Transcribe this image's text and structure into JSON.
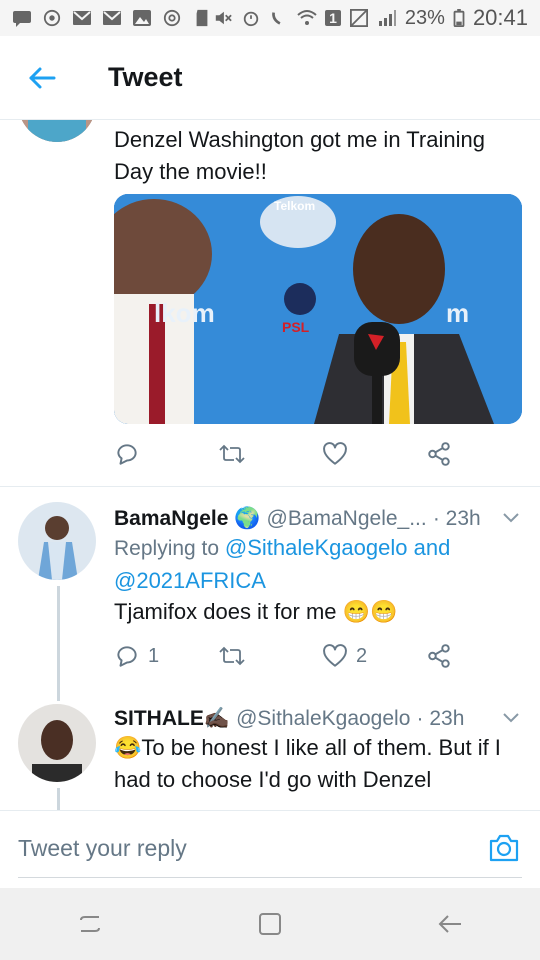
{
  "status_bar": {
    "battery_percent": "23%",
    "time": "20:41",
    "sim_badge": "1"
  },
  "header": {
    "title": "Tweet"
  },
  "tweet_main": {
    "text": "Denzel Washington got me in Training Day the movie!!",
    "media_banner_left": "lkom",
    "media_banner_right": "m",
    "media_logo_top": "Telkom",
    "media_psl": "PSL"
  },
  "replies": [
    {
      "name": "BamaNgele 🌍",
      "handle": "@BamaNgele_...",
      "time": "· 23h",
      "replying_prefix": "Replying to ",
      "replying_to": "@SithaleKgaogelo and @2021AFRICA",
      "text": "Tjamifox does it for me 😁😁",
      "reply_count": "1",
      "like_count": "2"
    },
    {
      "name": "SITHALE✍🏿",
      "handle": "@SithaleKgaogelo",
      "time": "· 23h",
      "text": "😂To be honest I like all of them. But if I had to choose I'd go with Denzel"
    }
  ],
  "reply_bar": {
    "placeholder": "Tweet your reply"
  },
  "colors": {
    "accent": "#1da1f2",
    "muted": "#657786",
    "link": "#1b95e0"
  }
}
